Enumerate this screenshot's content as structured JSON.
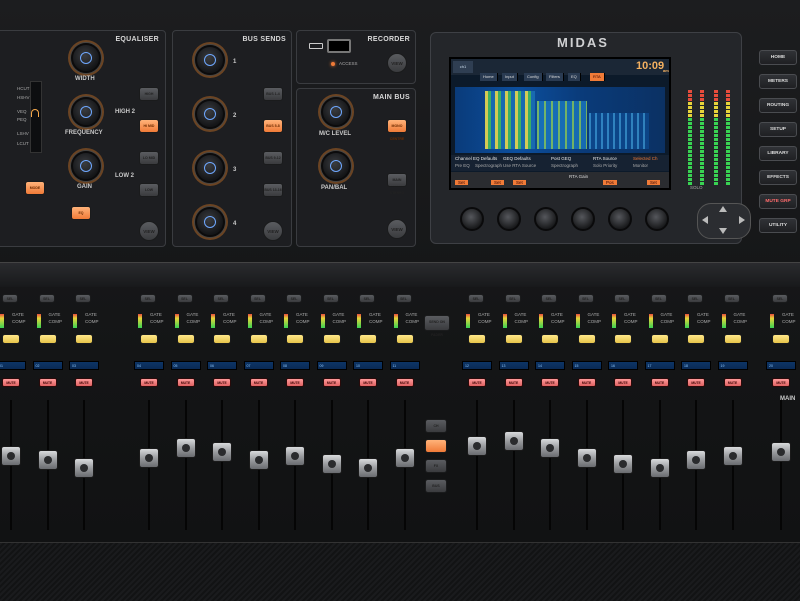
{
  "brand": {
    "logo": "MIDAS"
  },
  "equaliser": {
    "title": "EQUALISER",
    "width_label": "WIDTH",
    "frequency_label": "FREQUENCY",
    "gain_label": "GAIN",
    "high2_label": "HIGH 2",
    "low2_label": "LOW 2",
    "view_label": "VIEW",
    "mode_labels": [
      "HCUT",
      "HSHV",
      "VEQ",
      "PEQ",
      "LSHV",
      "LCUT"
    ],
    "btn_high": "HIGH",
    "btn_hi_mid": "HI MID",
    "btn_lo_mid": "LO MID",
    "btn_low": "LOW",
    "btn_mode": "MODE",
    "btn_eq": "EQ"
  },
  "bus_sends": {
    "title": "BUS SENDS",
    "numbers": [
      "1",
      "2",
      "3",
      "4"
    ],
    "view_label": "VIEW",
    "btns": [
      "BUS 1-4",
      "BUS 5-8",
      "BUS 9-12",
      "BUS 13-16"
    ]
  },
  "recorder": {
    "title": "RECORDER",
    "access_label": "ACCESS",
    "view_label": "VIEW"
  },
  "main_bus": {
    "title": "MAIN BUS",
    "mc_level_label": "M/C LEVEL",
    "pan_bal_label": "PAN/BAL",
    "view_label": "VIEW",
    "btn_mono": "MONO CENTRE",
    "btn_main": "MAIN STEREO"
  },
  "screen": {
    "time": "10:09",
    "clock_suffix": "am",
    "tabs": [
      "Home",
      "Input",
      "Config",
      "Filters",
      "EQ",
      "RTA"
    ],
    "channel_label": "ch1",
    "bottom_labels": [
      "Channel EQ Defaults",
      "GEQ Defaults",
      "Post GEQ",
      "RTA Source",
      "Selected Ch"
    ],
    "check_labels": [
      "Pre EQ",
      "Spectrograph",
      "Use RTA Source",
      "Spectrograph",
      "Solo Priority",
      "Monitor"
    ],
    "soft_keys": [
      "Set",
      "Set",
      "Set",
      "RTA Gain",
      "Pos",
      "Set"
    ],
    "meter_label": "SOLO"
  },
  "side_buttons": [
    "HOME",
    "METERS",
    "ROUTING",
    "SETUP",
    "LIBRARY",
    "EFFECTS",
    "MUTE GRP",
    "UTILITY"
  ],
  "channels": {
    "scribble": [
      "01",
      "02",
      "03",
      "04",
      "05",
      "06",
      "07",
      "08",
      "09",
      "10",
      "11",
      "12",
      "13",
      "14",
      "15",
      "16",
      "17",
      "18",
      "19",
      "20",
      "21",
      "22",
      "23"
    ],
    "mute_label": "MUTE",
    "sel_label": "SEL",
    "gate_label": "GATE",
    "comp_label": "COMP"
  },
  "center_buttons": [
    "SEND ON FADER",
    "CH",
    "FX",
    "BUS"
  ],
  "main_label": "MAIN",
  "fader_levels": [
    0.62,
    0.58,
    0.52,
    0.6,
    0.68,
    0.65,
    0.58,
    0.62,
    0.55,
    0.52,
    0.6,
    0.7,
    0.74,
    0.68,
    0.6,
    0.55,
    0.52,
    0.58,
    0.62,
    0.65,
    0.6,
    0.56,
    0.6
  ],
  "colors": {
    "accent": "#f07b38",
    "button_on": "#ffb37a",
    "mute": "#e06262",
    "knob_ring": "#6fa8ff",
    "scribble": "#0d3566",
    "meter_green": "#39d353",
    "meter_yellow": "#e7d43a",
    "meter_red": "#e74c3c"
  }
}
